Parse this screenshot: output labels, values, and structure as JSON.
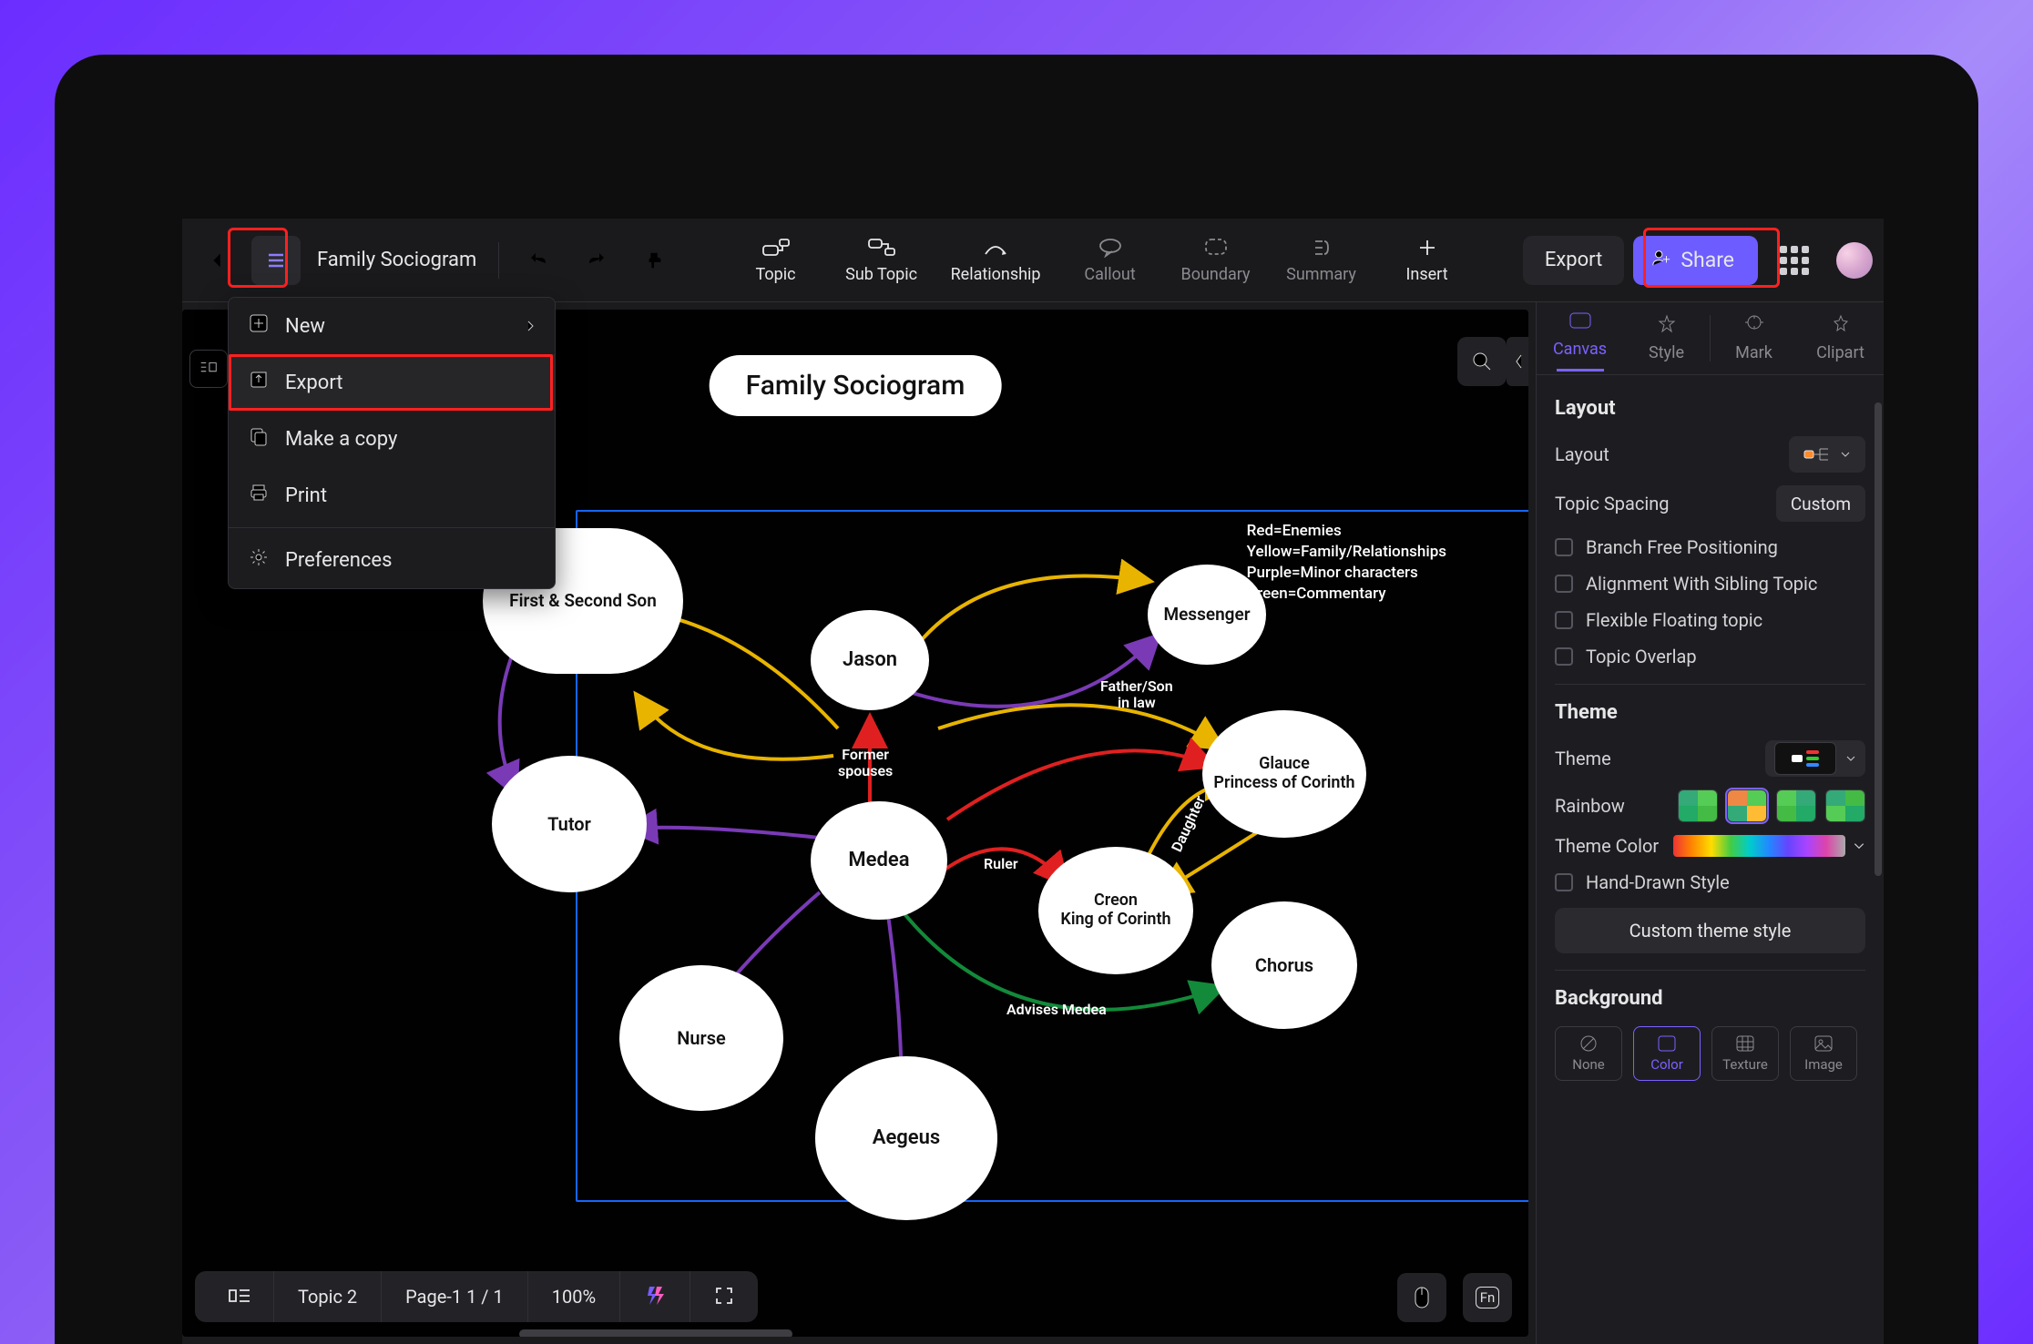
{
  "document": {
    "title": "Family Sociogram"
  },
  "toolbar": {
    "back": "Back",
    "tools": [
      {
        "name": "topic",
        "label": "Topic",
        "enabled": true
      },
      {
        "name": "subtopic",
        "label": "Sub Topic",
        "enabled": true
      },
      {
        "name": "relationship",
        "label": "Relationship",
        "enabled": true
      },
      {
        "name": "callout",
        "label": "Callout",
        "enabled": false
      },
      {
        "name": "boundary",
        "label": "Boundary",
        "enabled": false
      },
      {
        "name": "summary",
        "label": "Summary",
        "enabled": false
      },
      {
        "name": "insert",
        "label": "Insert",
        "enabled": true
      }
    ],
    "export_label": "Export",
    "share_label": "Share"
  },
  "menu": {
    "items": {
      "new": "New",
      "export": "Export",
      "make_copy": "Make a copy",
      "print": "Print",
      "preferences": "Preferences"
    }
  },
  "canvas": {
    "title": "Family Sociogram",
    "legend": {
      "l1": "Red=Enemies",
      "l2": "Yellow=Family/Relationships",
      "l3": "Purple=Minor characters",
      "l4": "Green=Commentary"
    },
    "nodes": {
      "first_second_son": "First & Second Son",
      "jason": "Jason",
      "messenger": "Messenger",
      "tutor": "Tutor",
      "medea": "Medea",
      "glauce": "Glauce\nPrincess of Corinth",
      "creon": "Creon\nKing of Corinth",
      "chorus": "Chorus",
      "nurse": "Nurse",
      "aegeus": "Aegeus"
    },
    "edges": {
      "former_spouses": "Former\nspouses",
      "father_son": "Father/Son\nin law",
      "daughter": "Daughter",
      "ruler": "Ruler",
      "advises": "Advises Medea"
    }
  },
  "bottombar": {
    "topic": "Topic 2",
    "page": "Page-1  1 / 1",
    "zoom": "100%"
  },
  "sidepanel": {
    "tabs": {
      "canvas": "Canvas",
      "style": "Style",
      "mark": "Mark",
      "clipart": "Clipart"
    },
    "layout": {
      "title": "Layout",
      "layout_label": "Layout",
      "spacing_label": "Topic Spacing",
      "spacing_value": "Custom",
      "opts": {
        "branch_free": "Branch Free Positioning",
        "align_sib": "Alignment With Sibling Topic",
        "flex_float": "Flexible Floating topic",
        "overlap": "Topic Overlap"
      }
    },
    "theme": {
      "title": "Theme",
      "theme_label": "Theme",
      "rainbow_label": "Rainbow",
      "theme_color_label": "Theme Color",
      "hand_drawn": "Hand-Drawn Style",
      "custom_style": "Custom theme style"
    },
    "background": {
      "title": "Background",
      "modes": {
        "none": "None",
        "color": "Color",
        "texture": "Texture",
        "image": "Image"
      }
    }
  }
}
